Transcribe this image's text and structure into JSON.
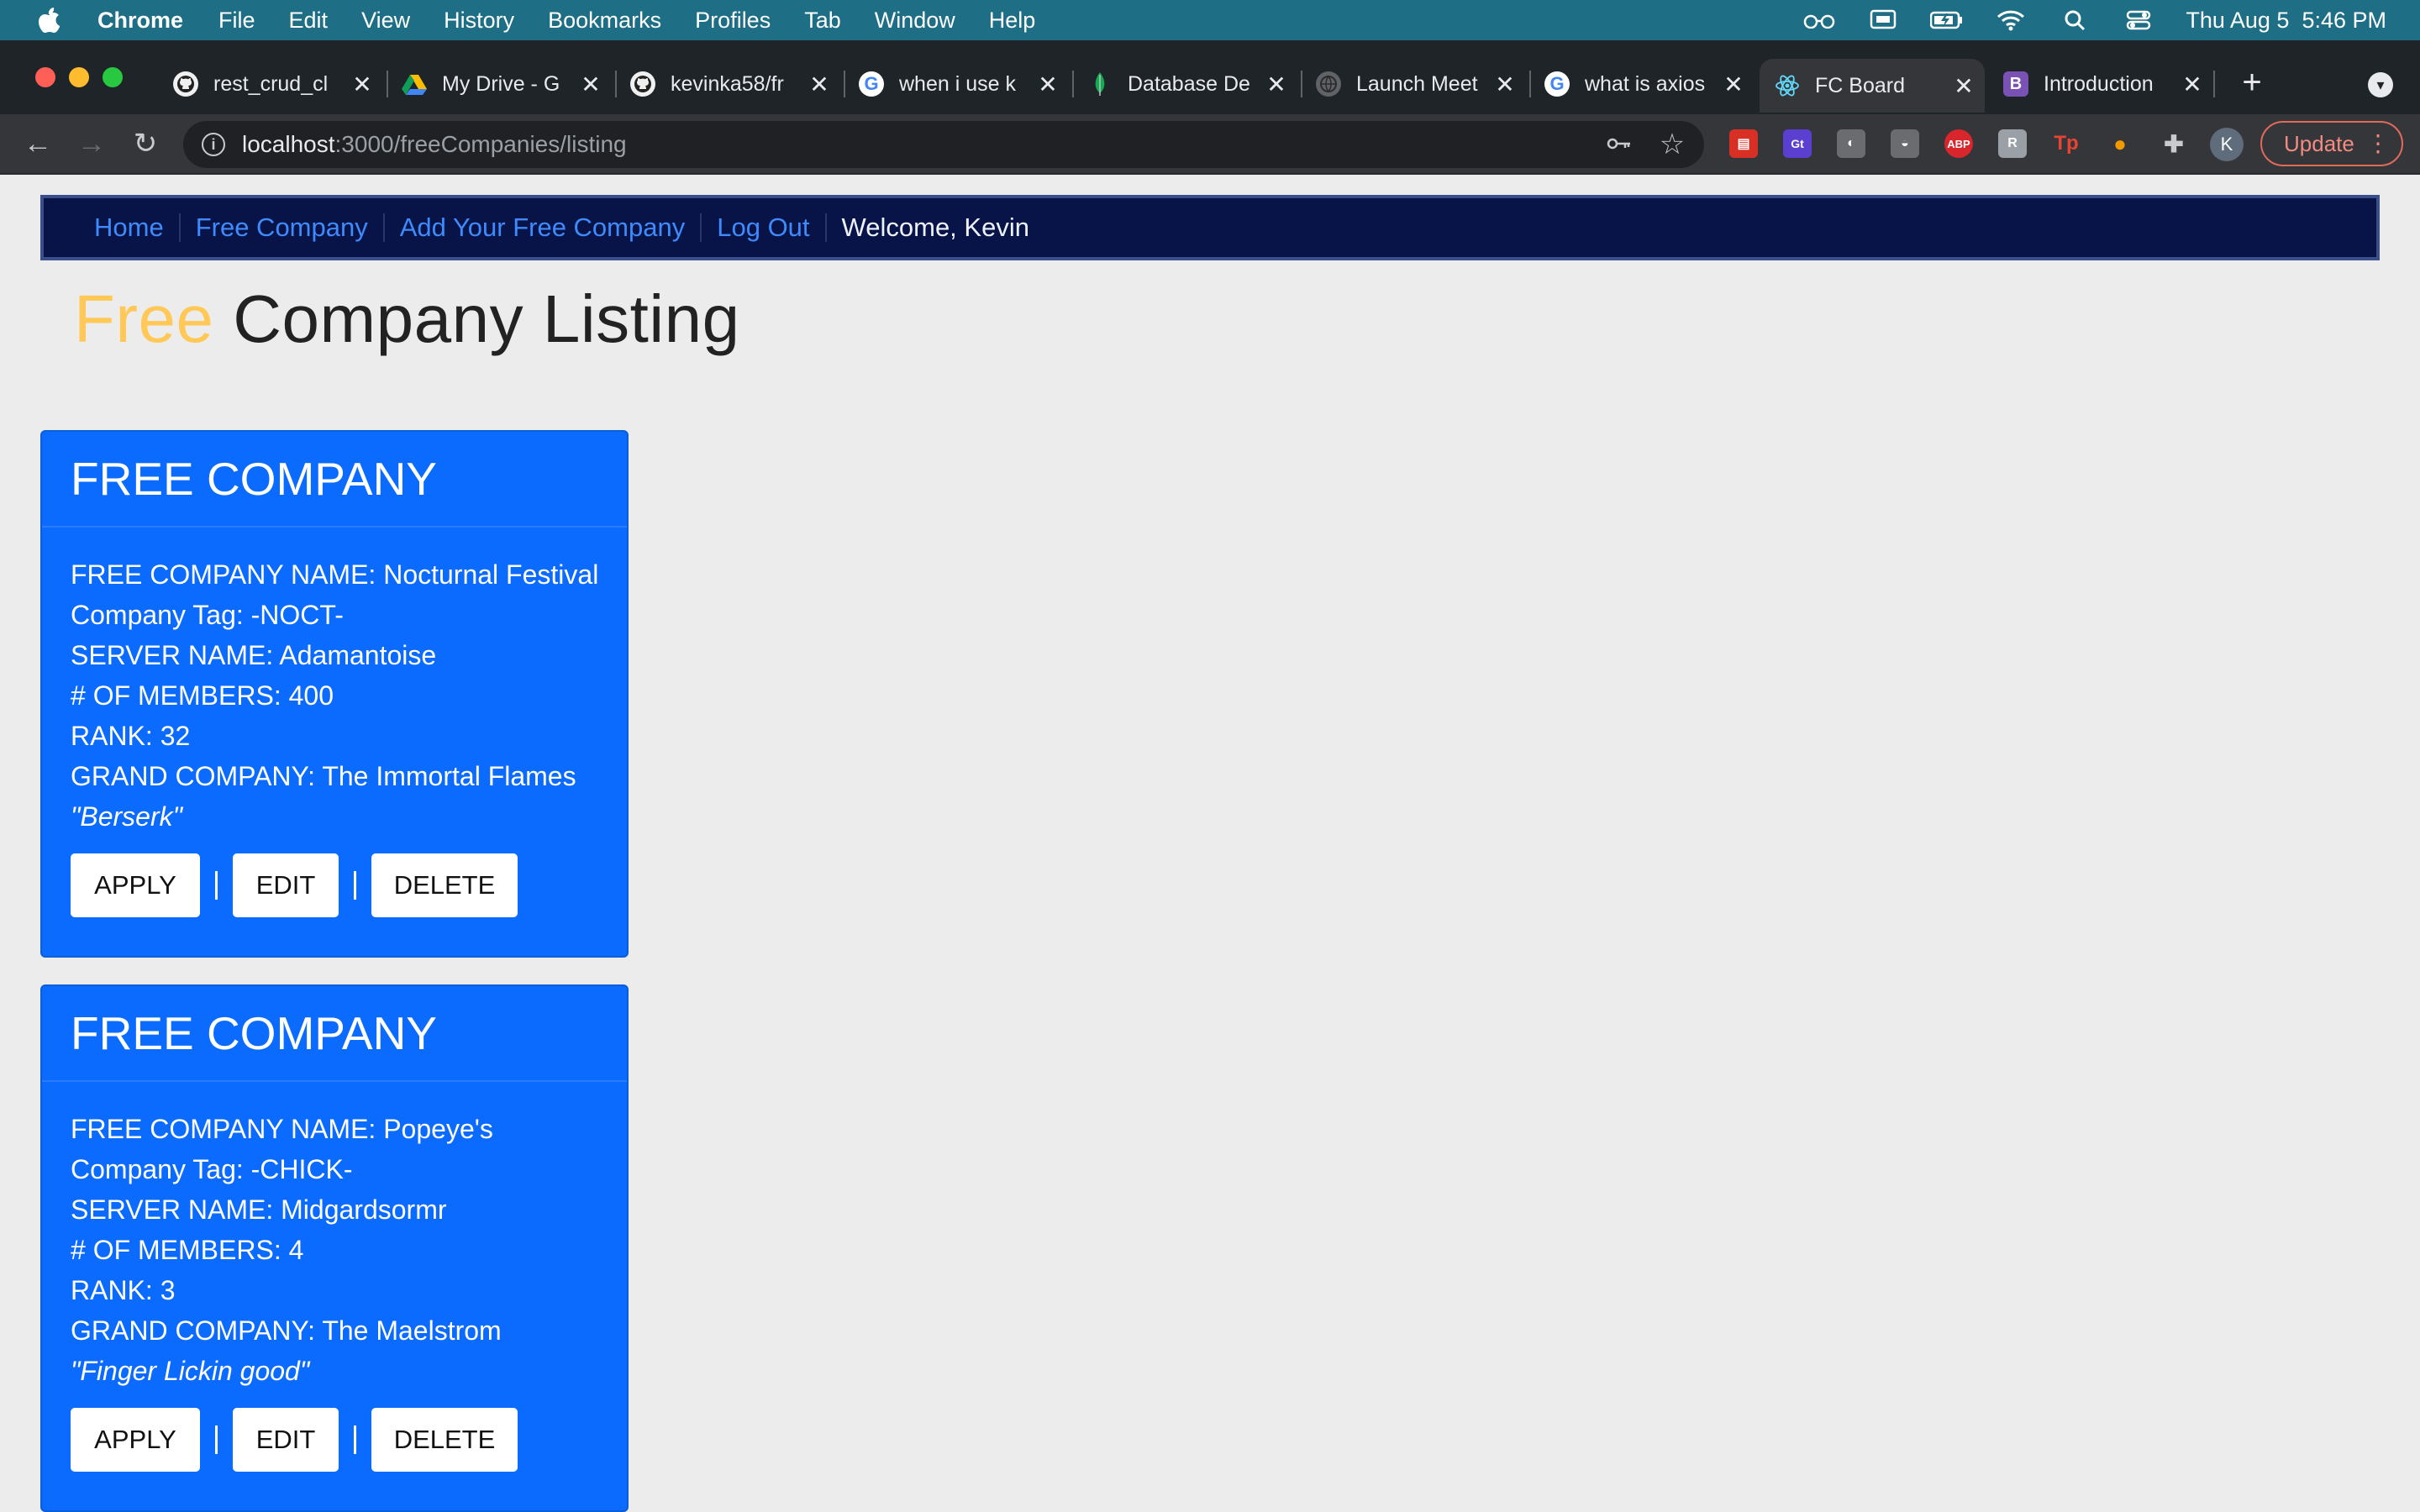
{
  "menubar": {
    "app": "Chrome",
    "items": [
      "File",
      "Edit",
      "View",
      "History",
      "Bookmarks",
      "Profiles",
      "Tab",
      "Window",
      "Help"
    ],
    "clock": "Thu Aug 5  5:46 PM"
  },
  "tabs": [
    {
      "title": "rest_crud_cl",
      "icon": "github-icon"
    },
    {
      "title": "My Drive - G",
      "icon": "google-drive-icon"
    },
    {
      "title": "kevinka58/fr",
      "icon": "github-icon"
    },
    {
      "title": "when i use k",
      "icon": "google-icon"
    },
    {
      "title": "Database De",
      "icon": "mongodb-icon"
    },
    {
      "title": "Launch Meet",
      "icon": "globe-icon"
    },
    {
      "title": "what is axios",
      "icon": "google-icon"
    },
    {
      "title": "FC Board",
      "icon": "react-icon",
      "active": true
    },
    {
      "title": "Introduction",
      "icon": "bootstrap-icon"
    }
  ],
  "toolbar": {
    "url_host": "localhost",
    "url_path": ":3000/freeCompanies/listing",
    "profile_initial": "K",
    "update_label": "Update"
  },
  "nav": {
    "home": "Home",
    "free_company": "Free Company",
    "add": "Add Your Free Company",
    "logout": "Log Out",
    "welcome": "Welcome, Kevin"
  },
  "heading": {
    "accent": "Free",
    "rest": " Company Listing"
  },
  "cards": [
    {
      "header": "FREE COMPANY",
      "name": "FREE COMPANY NAME: Nocturnal Festival",
      "tag": "Company Tag: -NOCT-",
      "server": "SERVER NAME: Adamantoise",
      "members": "# OF MEMBERS: 400",
      "rank": "RANK: 32",
      "grand_company": "GRAND COMPANY: The Immortal Flames",
      "motto": "\"Berserk\"",
      "apply": "APPLY",
      "edit": "EDIT",
      "delete": "DELETE"
    },
    {
      "header": "FREE COMPANY",
      "name": "FREE COMPANY NAME: Popeye's",
      "tag": "Company Tag: -CHICK-",
      "server": "SERVER NAME: Midgardsormr",
      "members": "# OF MEMBERS: 4",
      "rank": "RANK: 3",
      "grand_company": "GRAND COMPANY: The Maelstrom",
      "motto": "\"Finger Lickin good\"",
      "apply": "APPLY",
      "edit": "EDIT",
      "delete": "DELETE"
    }
  ],
  "colors": {
    "menubar": "#1e6e86",
    "nav_bg": "#081447",
    "link": "#3d8bfd",
    "card": "#0b6bff",
    "accent": "#ffc857"
  }
}
